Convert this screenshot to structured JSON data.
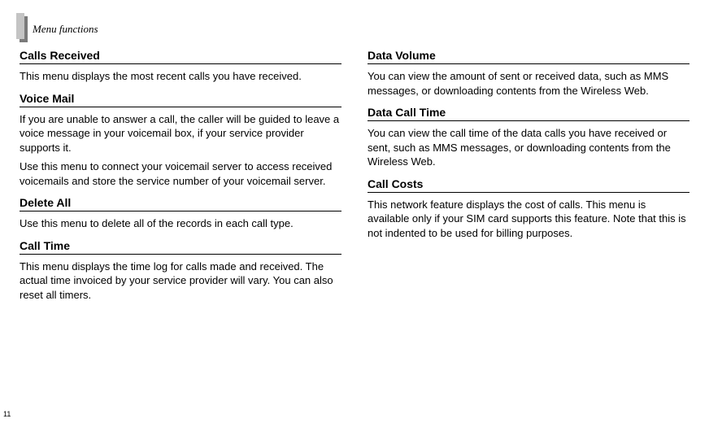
{
  "header": {
    "title": "Menu functions"
  },
  "left": {
    "sections": [
      {
        "title": "Calls Received",
        "paragraphs": [
          "This menu displays the most recent calls you have received."
        ]
      },
      {
        "title": "Voice Mail",
        "paragraphs": [
          "If you are unable to answer a call, the caller will be guided to leave a voice message in your voicemail box, if your service provider supports it.",
          "Use this menu to connect your voicemail server to access received voicemails and store the service number of your voicemail server."
        ]
      },
      {
        "title": "Delete All",
        "paragraphs": [
          "Use this menu to delete all of the records in each call type."
        ]
      },
      {
        "title": "Call Time",
        "paragraphs": [
          "This menu displays the time log for calls made and received. The actual time invoiced by your service provider will vary. You can also reset all timers."
        ]
      }
    ]
  },
  "right": {
    "sections": [
      {
        "title": "Data Volume",
        "paragraphs": [
          "You can view the amount of sent or received data, such as MMS messages, or downloading contents from the Wireless Web."
        ]
      },
      {
        "title": "Data Call Time",
        "paragraphs": [
          "You can view the call time of the data calls you have received or sent, such as MMS messages, or downloading contents from the Wireless Web."
        ]
      },
      {
        "title": "Call Costs",
        "paragraphs": [
          "This network feature displays the cost of calls. This menu is available only if your SIM card supports this feature. Note that this is not indented to be used for billing purposes."
        ]
      }
    ]
  },
  "page_number": "11"
}
